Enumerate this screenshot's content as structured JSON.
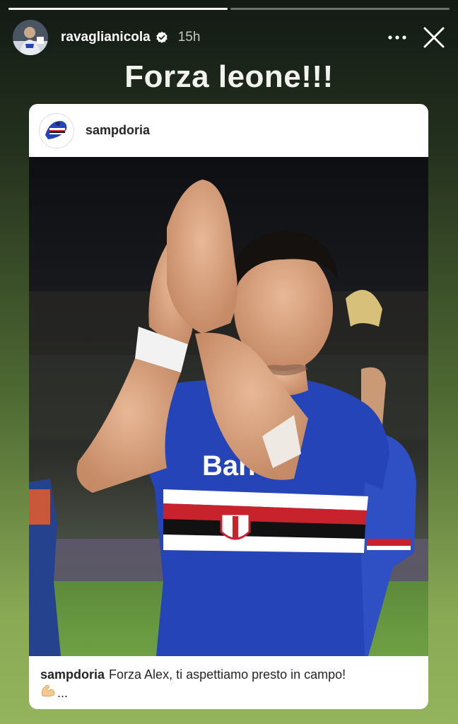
{
  "story": {
    "progress": [
      1.0,
      0.0
    ]
  },
  "header": {
    "username": "ravaglianicola",
    "timestamp": "15h"
  },
  "story_text": "Forza leone!!!",
  "post": {
    "account": "sampdoria",
    "caption_user": "sampdoria",
    "caption_text": "Forza Alex, ti aspettiamo presto in campo!",
    "caption_more": "...",
    "jersey_sponsor": "Banca"
  },
  "colors": {
    "verified_badge": "#3897f0",
    "jersey_blue": "#2544b8",
    "stripe_red": "#c8232c",
    "background_top": "#121a14",
    "background_bottom": "#94b35c"
  },
  "icons": {
    "more": "more-horizontal-icon",
    "close": "close-icon",
    "verified": "verified-badge-icon",
    "emoji": "flexed-biceps-emoji"
  }
}
